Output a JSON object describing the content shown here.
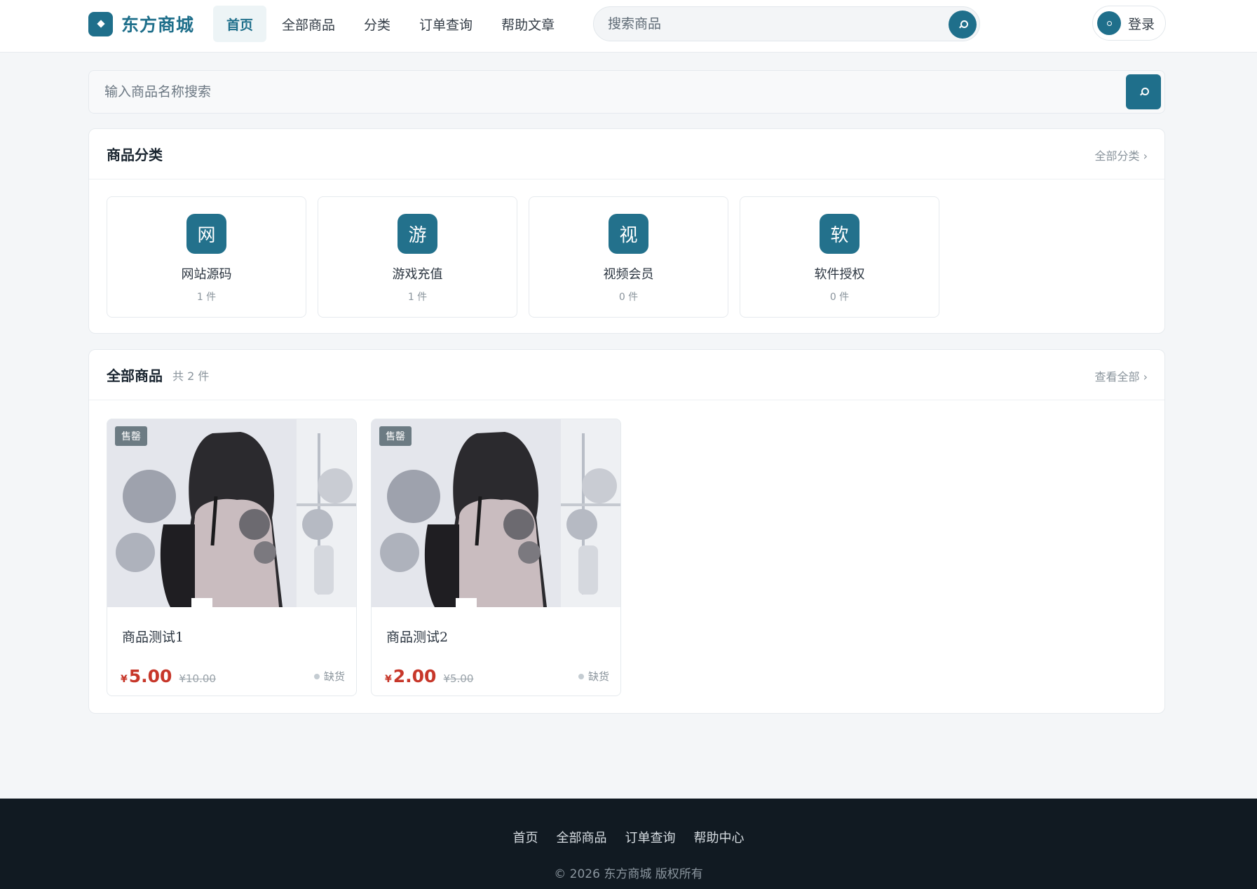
{
  "header": {
    "logo_text": "东方商城",
    "nav": [
      {
        "label": "首页",
        "active": true
      },
      {
        "label": "全部商品"
      },
      {
        "label": "分类"
      },
      {
        "label": "订单查询"
      },
      {
        "label": "帮助文章"
      }
    ],
    "search_placeholder": "搜索商品",
    "login_label": "登录"
  },
  "main_search": {
    "placeholder": "输入商品名称搜索"
  },
  "categories": {
    "title": "商品分类",
    "more": "全部分类 ›",
    "items": [
      {
        "icon": "网",
        "name": "网站源码",
        "count": "1 件"
      },
      {
        "icon": "游",
        "name": "游戏充值",
        "count": "1 件"
      },
      {
        "icon": "视",
        "name": "视频会员",
        "count": "0 件"
      },
      {
        "icon": "软",
        "name": "软件授权",
        "count": "0 件"
      }
    ]
  },
  "products": {
    "title": "全部商品",
    "subtitle": "共 2 件",
    "more": "查看全部 ›",
    "items": [
      {
        "badge": "售罄",
        "name": "商品测试1",
        "currency": "¥",
        "price": "5.00",
        "original": "¥10.00",
        "stock": "缺货"
      },
      {
        "badge": "售罄",
        "name": "商品测试2",
        "currency": "¥",
        "price": "2.00",
        "original": "¥5.00",
        "stock": "缺货"
      }
    ]
  },
  "footer": {
    "links": [
      "首页",
      "全部商品",
      "订单查询",
      "帮助中心"
    ],
    "copyright": "© 2026 东方商城 版权所有"
  },
  "colors": {
    "accent": "#1f6f8b",
    "price": "#c7372a",
    "footer_bg": "#111a22"
  }
}
